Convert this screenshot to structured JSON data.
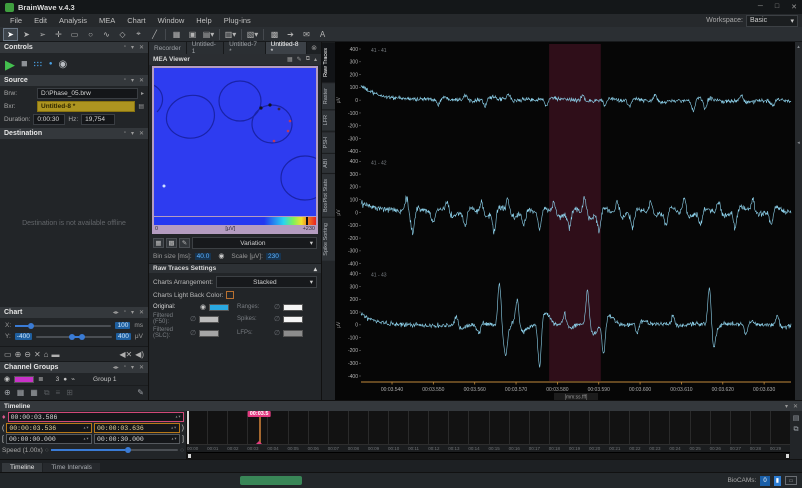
{
  "window": {
    "title": "BrainWave v.4.3",
    "minimize": "─",
    "maximize": "□",
    "close": "✕"
  },
  "menu": {
    "items": [
      "File",
      "Edit",
      "Analysis",
      "MEA",
      "Chart",
      "Window",
      "Help",
      "Plug-ins"
    ],
    "workspace_label": "Workspace:",
    "workspace_value": "Basic"
  },
  "toolbar": {
    "icons": [
      "select-cursor",
      "select-cursor-alt",
      "select-cursor-outline",
      "move-tool",
      "rect-select",
      "ellipse-select",
      "freehand-select",
      "polygon-select",
      "probe-tool",
      "line-tool",
      "separator",
      "grid-view",
      "grid-view-alt",
      "layout-dropdown",
      "separator",
      "layout2-dropdown",
      "separator",
      "measure-dropdown",
      "separator",
      "export-grid",
      "pointer-tool",
      "mail-tool",
      "text-tool"
    ]
  },
  "controls_panel": {
    "title": "Controls"
  },
  "source_panel": {
    "title": "Source",
    "brw_label": "Brw:",
    "brw_value": "D:\\Phase_05.brw",
    "bxr_label": "Bxr:",
    "bxr_value": "Untitled-8 *",
    "duration_label": "Duration:",
    "duration_value": "0:00:30",
    "hz_label": "Hz:",
    "hz_value": "19,754"
  },
  "destination_panel": {
    "title": "Destination",
    "message": "Destination is not available offline"
  },
  "chart_panel": {
    "title": "Chart",
    "x_label": "X:",
    "x_value": "100",
    "x_unit": "ms",
    "y_label": "Y:",
    "y_min": "-400",
    "y_max": "400",
    "y_unit": "μV"
  },
  "channel_groups": {
    "title": "Channel Groups",
    "rows": [
      {
        "color": "#c832c8",
        "count": "3",
        "name": "Group 1"
      }
    ]
  },
  "viewer": {
    "tabs": [
      {
        "label": "Recorder",
        "active": false
      },
      {
        "label": "Untitled-1",
        "active": false
      },
      {
        "label": "Untitled-7 *",
        "active": false
      },
      {
        "label": "Untitled-8 *",
        "active": true
      }
    ],
    "title": "MEA Viewer",
    "colorbar": {
      "left": "0",
      "center": "[μV]",
      "right": "+230"
    },
    "mode_value": "Variation",
    "bin_label": "Bin size [ms]:",
    "bin_value": "40.0",
    "scale_label": "Scale [μV]:",
    "scale_value": "230"
  },
  "raw_settings": {
    "title": "Raw Traces Settings",
    "arrangement_label": "Charts Arrangement:",
    "arrangement_value": "Stacked",
    "backcolor_label": "Charts Light Back Color:",
    "rows": [
      {
        "label": "Original:",
        "visible": true,
        "color": "#2aa8e0"
      },
      {
        "label": "Ranges:",
        "visible": false,
        "color": "#f5f5f5"
      },
      {
        "label": "Filtered (F50):",
        "visible": false,
        "color": "#bcbcbc"
      },
      {
        "label": "Spikes:",
        "visible": false,
        "color": "#f5f5f5"
      },
      {
        "label": "Filtered (SLC):",
        "visible": false,
        "color": "#a6a6a6"
      },
      {
        "label": "LFPs:",
        "visible": false,
        "color": "#8c8c8c"
      }
    ]
  },
  "chart_tabs": [
    "Raw Traces",
    "Raster",
    "LFR",
    "PSH",
    "ABI",
    "BoxPlot Stats",
    "Spike Sorting"
  ],
  "chart_data": {
    "type": "line",
    "title": "Raw Traces",
    "xlabel": "[mm:ss.fff]",
    "ylabel": "μV",
    "x_start_s": 3.5325,
    "x_end_s": 3.6365,
    "x_ticks": [
      {
        "t": 3.54,
        "label": "00:03.540"
      },
      {
        "t": 3.55,
        "label": "00:03.550"
      },
      {
        "t": 3.56,
        "label": "00:03.560"
      },
      {
        "t": 3.57,
        "label": "00:03.570"
      },
      {
        "t": 3.58,
        "label": "00:03.580"
      },
      {
        "t": 3.59,
        "label": "00:03.590"
      },
      {
        "t": 3.6,
        "label": "00:03.600"
      },
      {
        "t": 3.61,
        "label": "00:03.610"
      },
      {
        "t": 3.62,
        "label": "00:03.620"
      },
      {
        "t": 3.63,
        "label": "00:03.630"
      }
    ],
    "ylim": [
      -400,
      400
    ],
    "y_ticks": [
      400,
      300,
      200,
      100,
      0,
      -100,
      -200,
      -300,
      -400
    ],
    "selection_band_s": [
      3.578,
      3.5905
    ],
    "trace_color": "#8fd4ee",
    "axis_color": "#c28b3c",
    "grid": false,
    "series": [
      {
        "name": "41 - 41",
        "noise_uv": 16,
        "edge_start_uv": 115,
        "spikes": [
          {
            "t": 3.5512,
            "a": -50
          },
          {
            "t": 3.5577,
            "a": 40
          },
          {
            "t": 3.5625,
            "a": -60
          },
          {
            "t": 3.5682,
            "a": 45
          },
          {
            "t": 3.5774,
            "a": -55
          },
          {
            "t": 3.5862,
            "a": 40
          },
          {
            "t": 3.5916,
            "a": -45
          },
          {
            "t": 3.5975,
            "a": -55
          },
          {
            "t": 3.6037,
            "a": 45
          },
          {
            "t": 3.6129,
            "a": -85
          },
          {
            "t": 3.6157,
            "a": -75
          },
          {
            "t": 3.6245,
            "a": 50
          },
          {
            "t": 3.6321,
            "a": -45
          }
        ]
      },
      {
        "name": "41 - 42",
        "noise_uv": 24,
        "edge_start_uv": 70,
        "spikes": [
          {
            "t": 3.5435,
            "a": 120
          },
          {
            "t": 3.545,
            "a": -150
          },
          {
            "t": 3.55,
            "a": -100
          },
          {
            "t": 3.5533,
            "a": 90
          },
          {
            "t": 3.5577,
            "a": -130
          },
          {
            "t": 3.5617,
            "a": 100
          },
          {
            "t": 3.5647,
            "a": -150
          },
          {
            "t": 3.568,
            "a": 120
          },
          {
            "t": 3.5719,
            "a": -110
          },
          {
            "t": 3.5757,
            "a": -140
          },
          {
            "t": 3.5792,
            "a": 100
          },
          {
            "t": 3.5829,
            "a": -120
          },
          {
            "t": 3.5866,
            "a": 140
          },
          {
            "t": 3.5901,
            "a": -160
          },
          {
            "t": 3.5945,
            "a": 110
          },
          {
            "t": 3.5982,
            "a": -130
          },
          {
            "t": 3.6026,
            "a": 100
          },
          {
            "t": 3.6063,
            "a": -120
          },
          {
            "t": 3.6107,
            "a": 130
          },
          {
            "t": 3.6146,
            "a": -110
          },
          {
            "t": 3.619,
            "a": 90
          },
          {
            "t": 3.623,
            "a": -140
          },
          {
            "t": 3.6273,
            "a": 100
          },
          {
            "t": 3.6317,
            "a": -120
          }
        ]
      },
      {
        "name": "41 - 43",
        "noise_uv": 18,
        "edge_start_uv": 85,
        "spikes": [
          {
            "t": 3.5555,
            "a": 80
          },
          {
            "t": 3.561,
            "a": -70
          },
          {
            "t": 3.566,
            "a": 380
          },
          {
            "t": 3.5675,
            "a": -160
          },
          {
            "t": 3.5703,
            "a": 210
          },
          {
            "t": 3.5757,
            "a": -370
          },
          {
            "t": 3.5818,
            "a": 90
          },
          {
            "t": 3.5873,
            "a": 300
          },
          {
            "t": 3.5912,
            "a": -260
          },
          {
            "t": 3.5993,
            "a": -80
          },
          {
            "t": 3.608,
            "a": 70
          },
          {
            "t": 3.6168,
            "a": 330
          },
          {
            "t": 3.6178,
            "a": -130
          },
          {
            "t": 3.6256,
            "a": -90
          },
          {
            "t": 3.6332,
            "a": 80
          }
        ]
      }
    ]
  },
  "timeline": {
    "title": "Timeline",
    "marker_value": "00:00:03.586",
    "open_bracket": "(",
    "close_bracket": ")",
    "open_sq": "[",
    "close_sq": "]",
    "sel_start": "00:00:03.536",
    "sel_end": "00:00:03.636",
    "range_start": "00:00:00.000",
    "range_end": "00:00:30.000",
    "speed_label": "Speed (1.00x)",
    "cursor_label": "00:03.5",
    "cursor_s": 3.586,
    "duration_s": 30
  },
  "dock_tabs": [
    {
      "label": "Timeline",
      "active": true
    },
    {
      "label": "Time Intervals",
      "active": false
    }
  ],
  "status_bar": {
    "biocams_label": "BioCAMs:",
    "biocam_count": "0"
  }
}
